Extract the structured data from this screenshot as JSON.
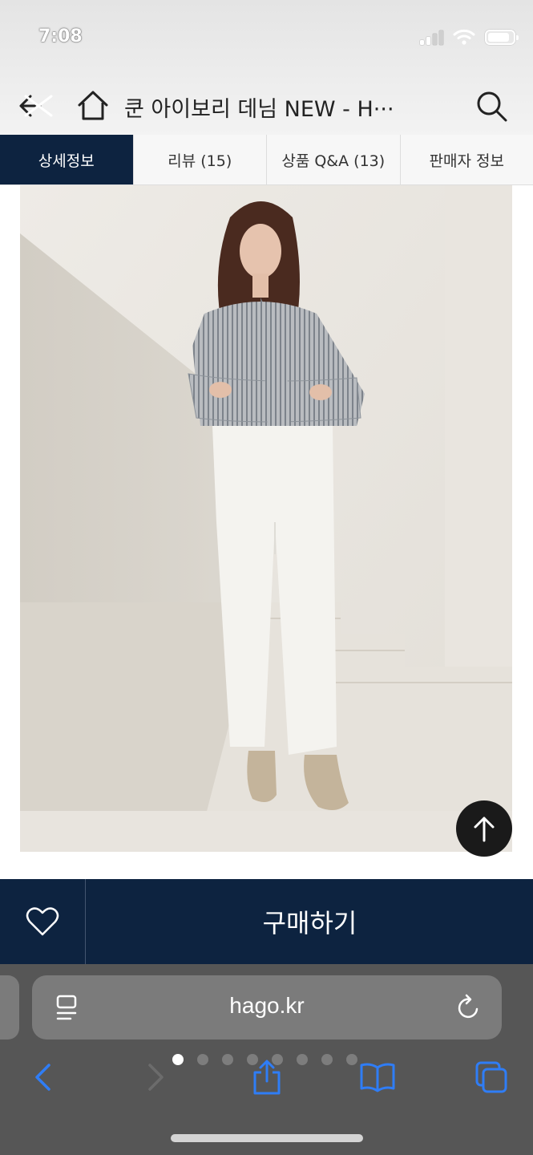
{
  "status_bar": {
    "time": "7:08"
  },
  "header": {
    "title": "쿤 아이보리 데님 NEW - H···"
  },
  "tabs": [
    {
      "label": "상세정보",
      "active": true
    },
    {
      "label": "리뷰 (15)",
      "active": false
    },
    {
      "label": "상품 Q&A (13)",
      "active": false
    },
    {
      "label": "판매자 정보",
      "active": false
    }
  ],
  "purchase_bar": {
    "buy_label": "구매하기"
  },
  "browser": {
    "url": "hago.kr",
    "page_dots": 8,
    "active_dot": 0
  },
  "colors": {
    "navy": "#0d2340",
    "safari_gray": "#565656"
  }
}
